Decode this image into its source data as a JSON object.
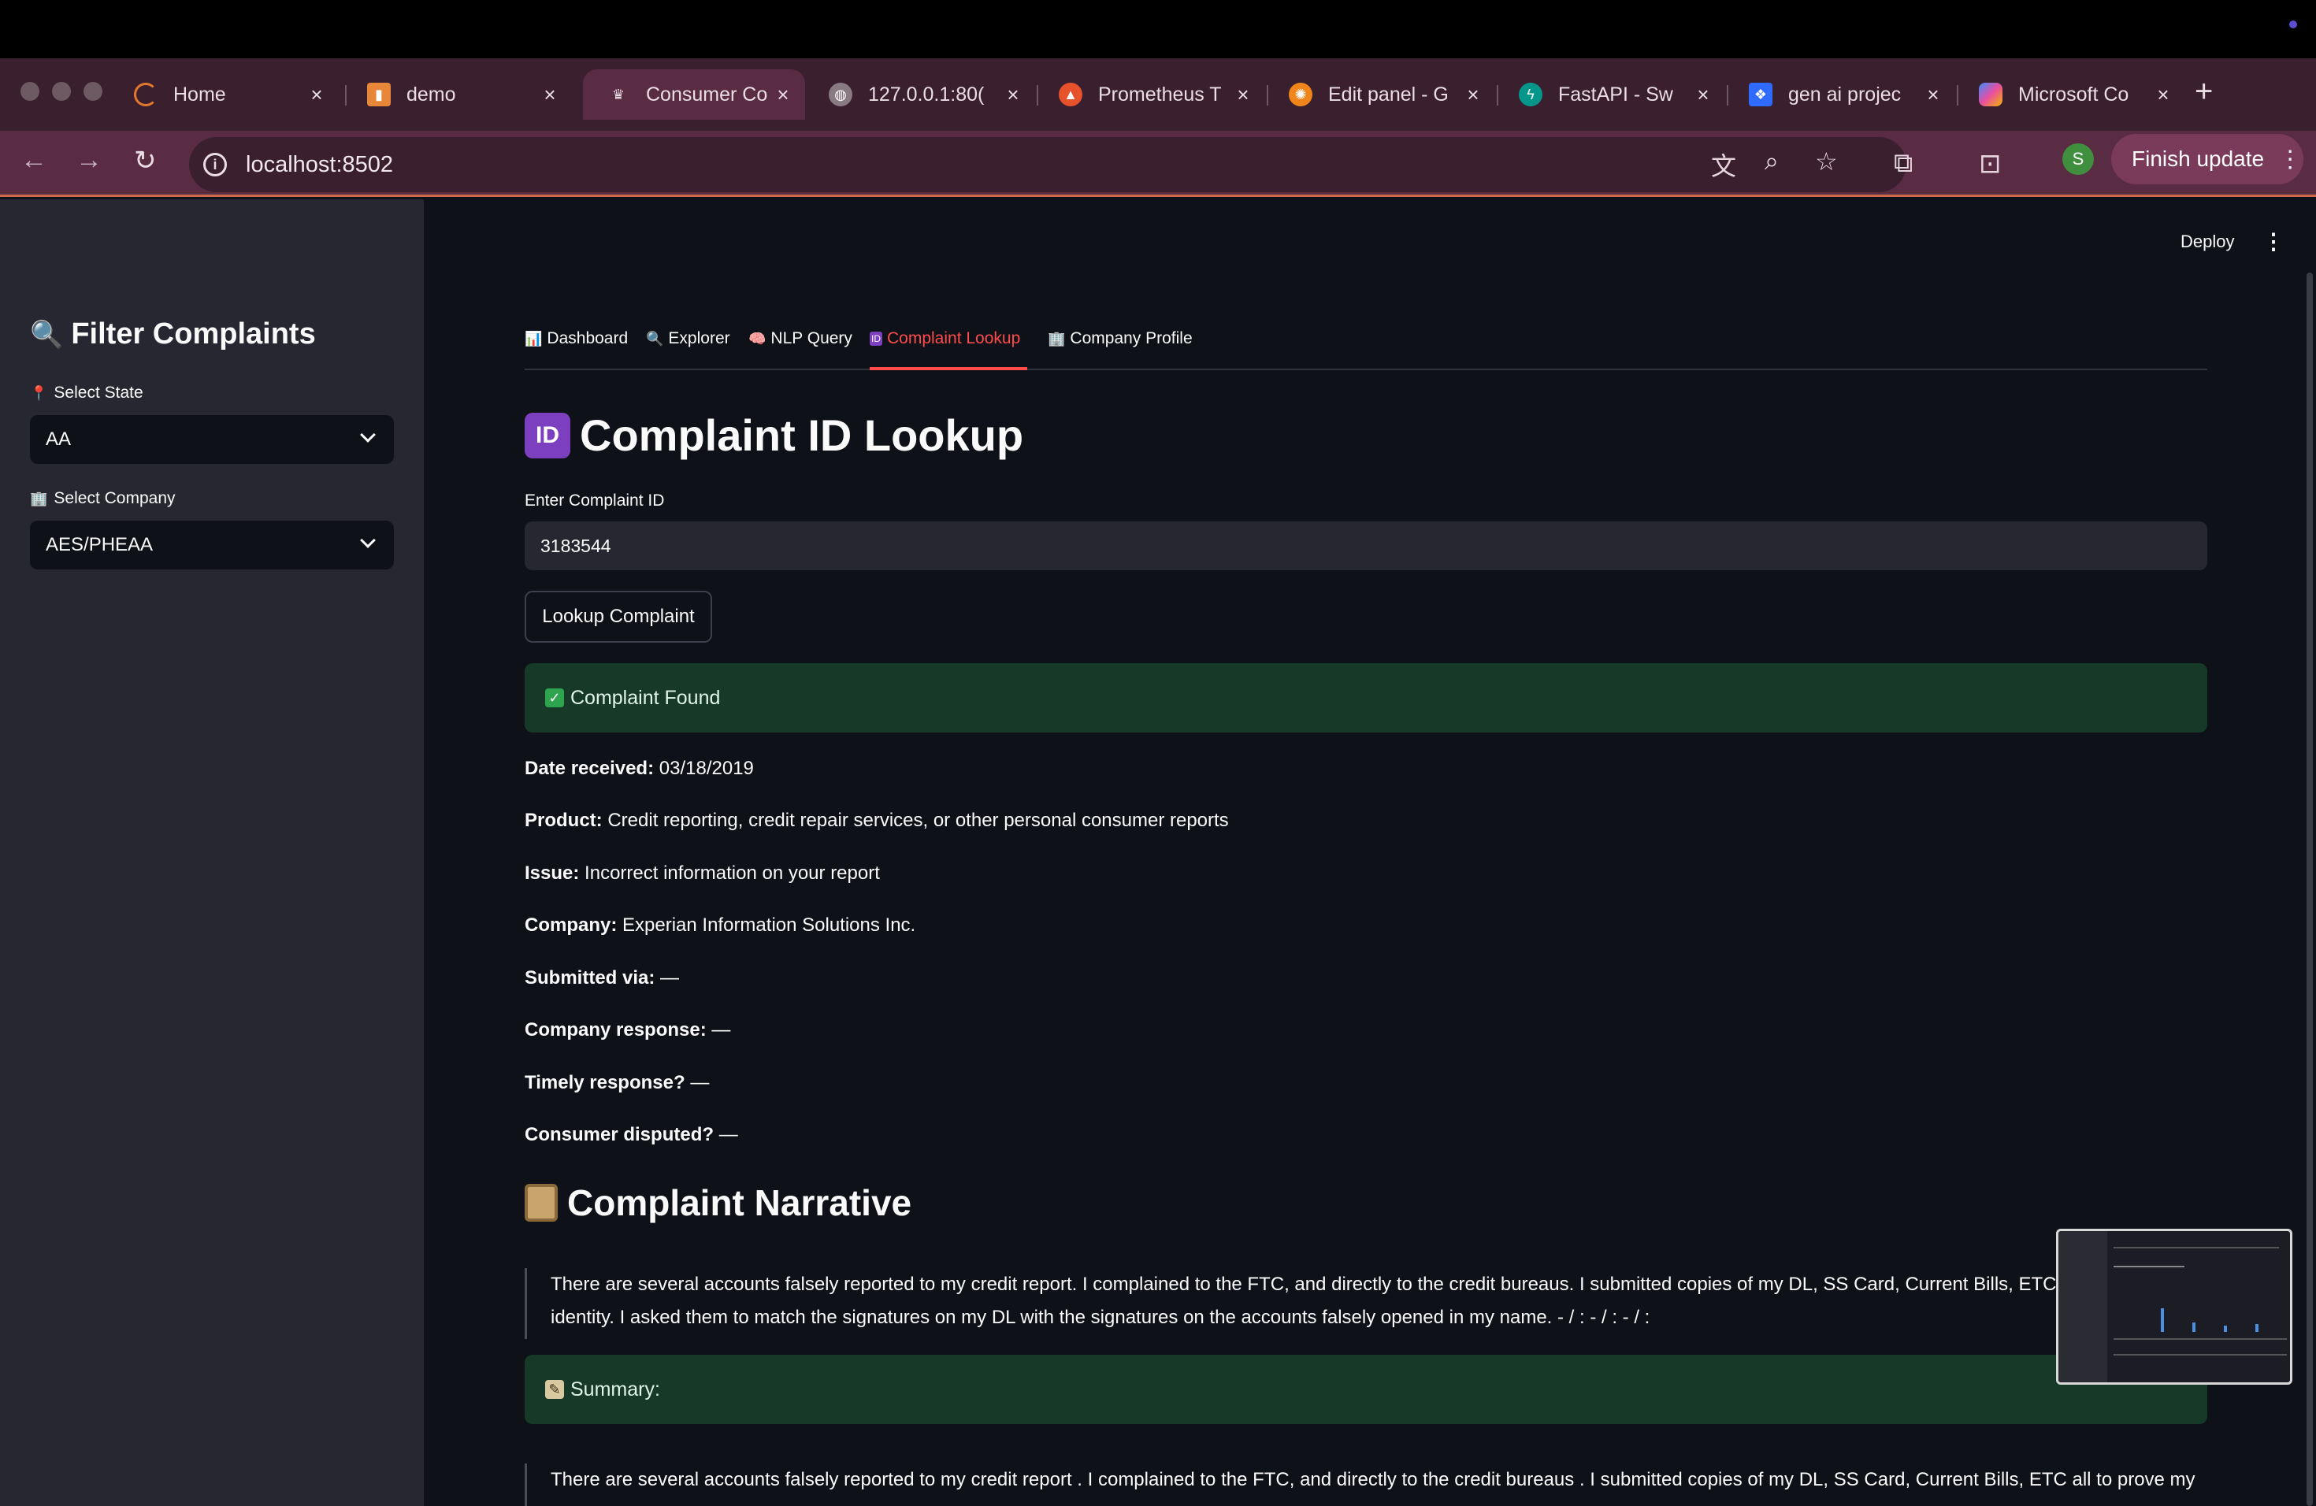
{
  "browser": {
    "tabs": [
      {
        "title": "Home",
        "icon": "spinner-icon",
        "active": false
      },
      {
        "title": "demo",
        "icon": "book-icon",
        "active": false
      },
      {
        "title": "Consumer Co",
        "icon": "streamlit-crown-icon",
        "active": true
      },
      {
        "title": "127.0.0.1:80(",
        "icon": "globe-icon",
        "active": false
      },
      {
        "title": "Prometheus T",
        "icon": "prometheus-icon",
        "active": false
      },
      {
        "title": "Edit panel - G",
        "icon": "grafana-icon",
        "active": false
      },
      {
        "title": "FastAPI - Sw",
        "icon": "fastapi-icon",
        "active": false
      },
      {
        "title": "gen ai projec",
        "icon": "dropbox-icon",
        "active": false
      },
      {
        "title": "Microsoft Co",
        "icon": "copilot-icon",
        "active": false
      }
    ],
    "url": "localhost:8502",
    "profile_initial": "S",
    "finish_update_label": "Finish update"
  },
  "header": {
    "deploy_label": "Deploy"
  },
  "sidebar": {
    "title": "Filter Complaints",
    "state_label": "Select State",
    "state_value": "AA",
    "company_label": "Select Company",
    "company_value": "AES/PHEAA"
  },
  "nav_tabs": [
    {
      "label": "Dashboard",
      "icon": "bar-chart-icon"
    },
    {
      "label": "Explorer",
      "icon": "magnifier-icon"
    },
    {
      "label": "NLP Query",
      "icon": "brain-icon"
    },
    {
      "label": "Complaint Lookup",
      "icon": "id-icon",
      "active": true
    },
    {
      "label": "Company Profile",
      "icon": "building-icon"
    }
  ],
  "main": {
    "title": "Complaint ID Lookup",
    "input_label": "Enter Complaint ID",
    "input_value": "3183544",
    "button_label": "Lookup Complaint",
    "found_message": "Complaint Found",
    "fields": [
      {
        "key": "Date received:",
        "value": "03/18/2019"
      },
      {
        "key": "Product:",
        "value": "Credit reporting, credit repair services, or other personal consumer reports"
      },
      {
        "key": "Issue:",
        "value": "Incorrect information on your report"
      },
      {
        "key": "Company:",
        "value": "Experian Information Solutions Inc."
      },
      {
        "key": "Submitted via:",
        "value": "—"
      },
      {
        "key": "Company response:",
        "value": "—"
      },
      {
        "key": "Timely response?",
        "value": "—"
      },
      {
        "key": "Consumer disputed?",
        "value": "—"
      }
    ],
    "narrative_title": "Complaint Narrative",
    "narrative_line1": "There are several accounts falsely reported to my credit report. I complained to the FTC, and directly to the credit bureaus. I submitted copies of my DL, SS Card, Current Bills, ETC all",
    "narrative_line2": "identity. I asked them to match the signatures on my DL with the signatures on the accounts falsely opened in my name. - / : - / : - / :",
    "summary_label": "Summary:",
    "summary_line1": "There are several accounts falsely reported to my credit report . I complained to the FTC, and directly to the credit bureaus . I submitted copies of my DL, SS Card, Current Bills, ETC all to prove my"
  },
  "colors": {
    "accent": "#ff4b4b",
    "success_bg": "#173928",
    "sidebar_bg": "#262730",
    "app_bg": "#0e1117",
    "browser_frame": "#5a2c43"
  }
}
